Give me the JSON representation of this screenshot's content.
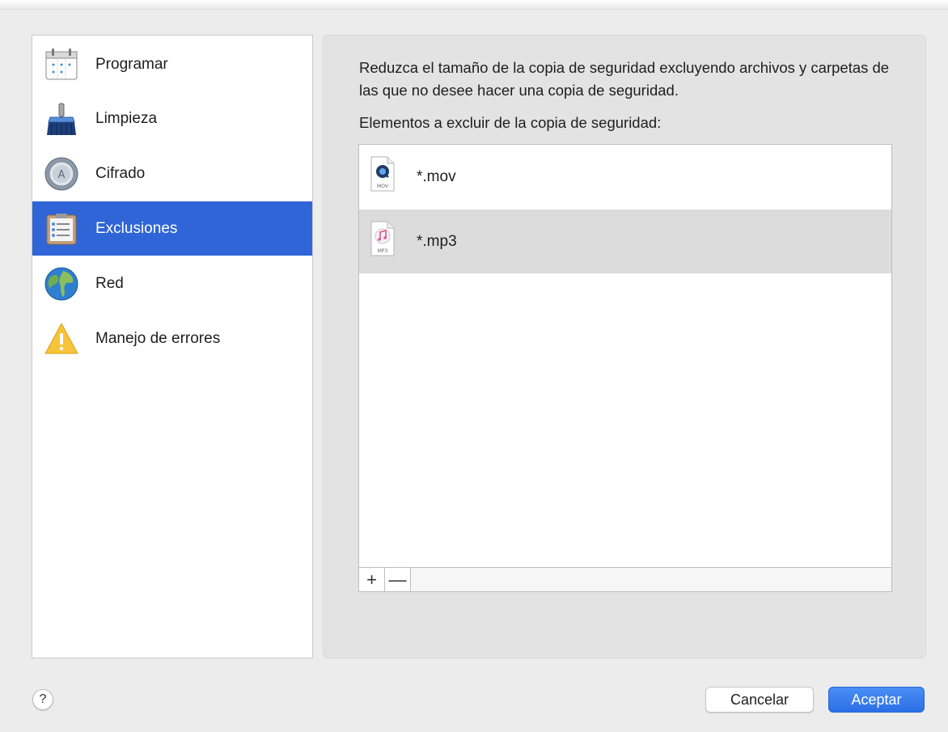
{
  "sidebar": {
    "items": [
      {
        "label": "Programar",
        "icon": "calendar-icon"
      },
      {
        "label": "Limpieza",
        "icon": "broom-icon"
      },
      {
        "label": "Cifrado",
        "icon": "lock-dial-icon"
      },
      {
        "label": "Exclusiones",
        "icon": "checklist-icon",
        "selected": true
      },
      {
        "label": "Red",
        "icon": "globe-icon"
      },
      {
        "label": "Manejo de errores",
        "icon": "warning-icon"
      }
    ]
  },
  "main": {
    "description": "Reduzca el tamaño de la copia de seguridad excluyendo archivos y carpetas de las que no desee hacer una copia de seguridad.",
    "list_title": "Elementos a excluir de la copia de seguridad:",
    "exclusions": [
      {
        "name": "*.mov",
        "icon": "mov-file-icon",
        "badge": "MOV"
      },
      {
        "name": "*.mp3",
        "icon": "mp3-file-icon",
        "badge": "MP3"
      }
    ],
    "add_label": "+",
    "remove_label": "—"
  },
  "footer": {
    "help_label": "?",
    "cancel_label": "Cancelar",
    "ok_label": "Aceptar"
  },
  "colors": {
    "selection": "#2f65d6",
    "primary_button": "#2b6fe6",
    "panel_bg": "#e3e3e3"
  }
}
